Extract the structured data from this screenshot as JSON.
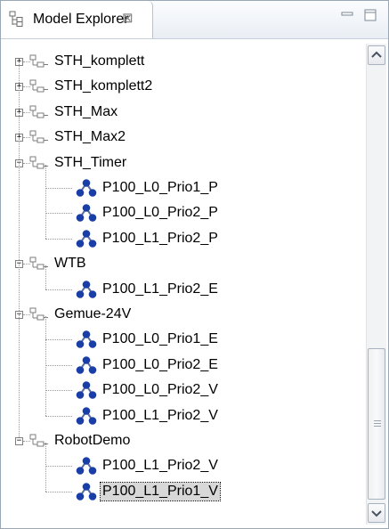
{
  "view": {
    "title": "Model Explorer",
    "close_glyph": "⊠",
    "minimize_icon": "minimize-icon",
    "maximize_icon": "maximize-icon"
  },
  "tree": {
    "projects": [
      {
        "label": "STH_komplett",
        "expanded": false,
        "children": []
      },
      {
        "label": "STH_komplett2",
        "expanded": false,
        "children": []
      },
      {
        "label": "STH_Max",
        "expanded": false,
        "children": []
      },
      {
        "label": "STH_Max2",
        "expanded": false,
        "children": []
      },
      {
        "label": "STH_Timer",
        "expanded": true,
        "children": [
          "P100_L0_Prio1_P",
          "P100_L0_Prio2_P",
          "P100_L1_Prio2_P"
        ]
      },
      {
        "label": "WTB",
        "expanded": true,
        "children": [
          "P100_L1_Prio2_E"
        ]
      },
      {
        "label": "Gemue-24V",
        "expanded": true,
        "children": [
          "P100_L0_Prio1_E",
          "P100_L0_Prio2_E",
          "P100_L0_Prio2_V",
          "P100_L1_Prio2_V"
        ]
      },
      {
        "label": "RobotDemo",
        "expanded": true,
        "children": [
          "P100_L1_Prio2_V",
          "P100_L1_Prio1_V"
        ]
      }
    ],
    "selected": "RobotDemo/P100_L1_Prio1_V"
  },
  "icons": {
    "project": "project-folder-icon",
    "model": "model-node-icon",
    "view": "model-explorer-icon"
  },
  "colors": {
    "selection": "#d8d8d8",
    "model_icon": "#1a3ea8",
    "folder_icon": "#8a8a8a"
  }
}
